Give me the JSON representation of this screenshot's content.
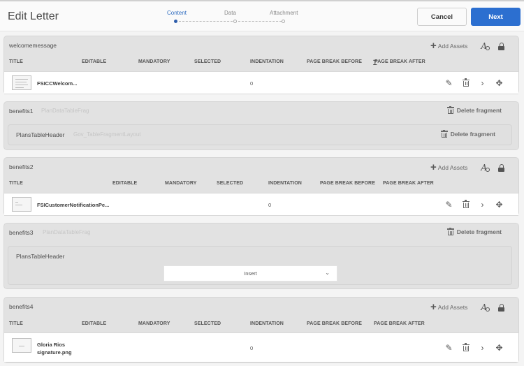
{
  "header": {
    "title": "Edit Letter",
    "steps": [
      {
        "label": "Content",
        "active": true
      },
      {
        "label": "Data",
        "active": false
      },
      {
        "label": "Attachment",
        "active": false
      }
    ],
    "cancel_label": "Cancel",
    "next_label": "Next",
    "accent_color": "#2c6fd0"
  },
  "common": {
    "add_assets_label": "Add Assets",
    "delete_fragment_label": "Delete fragment",
    "insert_placeholder": "Insert"
  },
  "columns_wide": [
    "TITLE",
    "EDITABLE",
    "MANDATORY",
    "SELECTED",
    "INDENTATION",
    "PAGE BREAK BEFORE",
    "PAGE BREAK AFTER"
  ],
  "sections": {
    "welcome": {
      "name": "welcomemessage",
      "row": {
        "title": "FSICCWelcom...",
        "indentation": "0"
      }
    },
    "benefits1": {
      "name": "benefits1",
      "subtitle": "PlanDataTableFrag",
      "inner": {
        "name": "PlansTableHeader",
        "subtitle": "Gov_TableFragmentLayout"
      }
    },
    "benefits2": {
      "name": "benefits2",
      "row": {
        "title": "FSICustomerNotificationPe...",
        "indentation": "0"
      }
    },
    "benefits3": {
      "name": "benefits3",
      "subtitle": "PlanDataTableFrag",
      "inner": {
        "name": "PlansTableHeader"
      }
    },
    "benefits4": {
      "name": "benefits4",
      "row": {
        "title_line1": "Gloria Rios",
        "title_line2": "signature.png",
        "indentation": "0"
      }
    }
  }
}
